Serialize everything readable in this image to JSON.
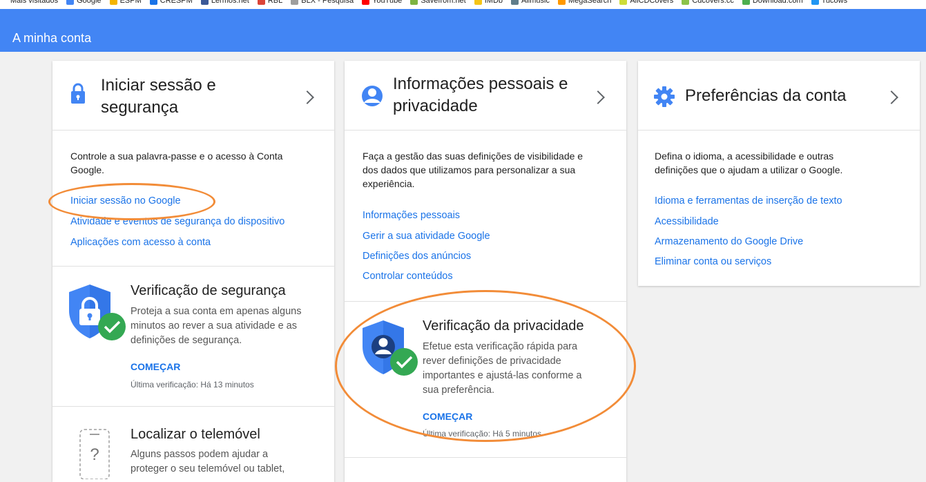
{
  "bookmarks": [
    {
      "label": "Mais visitados",
      "color": "#ffffff"
    },
    {
      "label": "Google",
      "color": "#4285f4"
    },
    {
      "label": "ESPM",
      "color": "#f4b400"
    },
    {
      "label": "CRESPM",
      "color": "#1a73e8"
    },
    {
      "label": "Lermos.net",
      "color": "#3b5998"
    },
    {
      "label": "RBL",
      "color": "#db4437"
    },
    {
      "label": "BLX - Pesquisa",
      "color": "#9e9e9e"
    },
    {
      "label": "YouTube",
      "color": "#ff0000"
    },
    {
      "label": "Savefrom.net",
      "color": "#7cb342"
    },
    {
      "label": "IMDb",
      "color": "#f5c518"
    },
    {
      "label": "Allmusic",
      "color": "#607d8b"
    },
    {
      "label": "MegaSearch",
      "color": "#ff9800"
    },
    {
      "label": "AllCDCovers",
      "color": "#cddc39"
    },
    {
      "label": "Cdcovers.cc",
      "color": "#8bc34a"
    },
    {
      "label": "Download.com",
      "color": "#4caf50"
    },
    {
      "label": "Tucows",
      "color": "#2196f3"
    }
  ],
  "appbar": {
    "title": "A minha conta",
    "color": "#4285f4"
  },
  "cards": {
    "security": {
      "title_line1": "Iniciar sessão e",
      "title_line2": "segurança",
      "desc_line1": "Controle a sua palavra-passe e o acesso à Conta",
      "desc_line2": "Google.",
      "links": [
        "Iniciar sessão no Google",
        "Atividade e eventos de segurança do dispositivo",
        "Aplicações com acesso à conta"
      ],
      "checkup": {
        "title": "Verificação de segurança",
        "body_line1": "Proteja a sua conta em apenas alguns",
        "body_line2": "minutos ao rever a sua atividade e as",
        "body_line3": "definições de segurança.",
        "action": "COMEÇAR",
        "last": "Última verificação: Há 13 minutos"
      },
      "phone": {
        "title": "Localizar o telemóvel",
        "body_line1": "Alguns passos podem ajudar a",
        "body_line2": "proteger o seu telemóvel ou tablet,",
        "icon_text": "?"
      }
    },
    "privacy": {
      "title_line1": "Informações pessoais e",
      "title_line2": "privacidade",
      "desc_line1": "Faça a gestão das suas definições de visibilidade e",
      "desc_line2": "dos dados que utilizamos para personalizar a sua",
      "desc_line3": "experiência.",
      "links": [
        "Informações pessoais",
        "Gerir a sua atividade Google",
        "Definições dos anúncios",
        "Controlar conteúdos"
      ],
      "checkup": {
        "title": "Verificação da privacidade",
        "body_line1": "Efetue esta verificação rápida para",
        "body_line2": "rever definições de privacidade",
        "body_line3": "importantes e ajustá-las conforme a",
        "body_line4": "sua preferência.",
        "action": "COMEÇAR",
        "last": "Última verificação: Há 5 minutos"
      }
    },
    "preferences": {
      "title": "Preferências da conta",
      "desc_line1": "Defina o idioma, a acessibilidade e outras",
      "desc_line2": "definições que o ajudam a utilizar o Google.",
      "links": [
        "Idioma e ferramentas de inserção de texto",
        "Acessibilidade",
        "Armazenamento do Google Drive",
        "Eliminar conta ou serviços"
      ]
    }
  },
  "colors": {
    "link": "#1a73e8",
    "annotation": "#f28c38",
    "shield": "#4285f4",
    "check": "#34a853"
  }
}
